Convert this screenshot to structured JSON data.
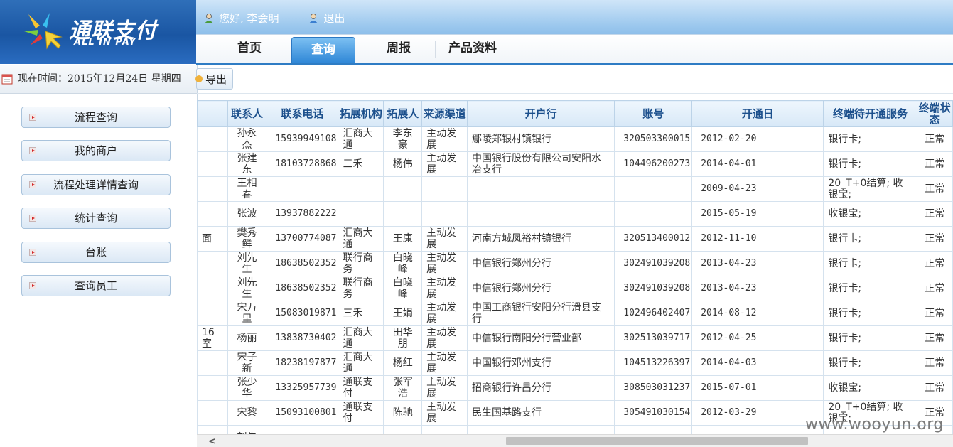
{
  "header": {
    "brand_cn": "通联支付",
    "brand_en": "ALL IN PAY",
    "greeting": "您好, 李会明",
    "logout": "退出",
    "nav": [
      "首页",
      "查询",
      "周报",
      "产品资料"
    ],
    "active_nav": "查询"
  },
  "sidebar": {
    "date_label": "现在时间：",
    "date_value": "2015年12月24日 星期四",
    "items": [
      "流程查询",
      "我的商户",
      "流程处理详情查询",
      "统计查询",
      "台账",
      "查询员工"
    ]
  },
  "toolbar": {
    "export_label": "导出"
  },
  "table": {
    "columns": [
      "联系人",
      "联系电话",
      "拓展机构",
      "拓展人",
      "来源渠道",
      "开户行",
      "账号",
      "开通日",
      "终端待开通服务",
      "终端状态"
    ],
    "rows": [
      {
        "prefix": "",
        "contact": "孙永杰",
        "phone": "15939949108",
        "org": "汇商大通",
        "agent": "李东豪",
        "channel": "主动发展",
        "bank": "鄢陵郑银村镇银行",
        "account": "320503300015",
        "date": "2012-02-20",
        "service": "银行卡;",
        "status": "正常"
      },
      {
        "prefix": "",
        "contact": "张建东",
        "phone": "18103728868",
        "org": "三禾",
        "agent": "杨伟",
        "channel": "主动发展",
        "bank": "中国银行股份有限公司安阳水冶支行",
        "account": "104496200273",
        "date": "2014-04-01",
        "service": "银行卡;",
        "status": "正常"
      },
      {
        "prefix": "",
        "contact": "王相春",
        "phone": "",
        "org": "",
        "agent": "",
        "channel": "",
        "bank": "",
        "account": "",
        "date": "2009-04-23",
        "service": "20_T+0结算; 收银宝;",
        "status": "正常"
      },
      {
        "prefix": "",
        "contact": "张波",
        "phone": "13937882222",
        "org": "",
        "agent": "",
        "channel": "",
        "bank": "",
        "account": "",
        "date": "2015-05-19",
        "service": "收银宝;",
        "status": "正常"
      },
      {
        "prefix": "面",
        "contact": "樊秀鲜",
        "phone": "13700774087",
        "org": "汇商大通",
        "agent": "王康",
        "channel": "主动发展",
        "bank": "河南方城凤裕村镇银行",
        "account": "320513400012",
        "date": "2012-11-10",
        "service": "银行卡;",
        "status": "正常"
      },
      {
        "prefix": "",
        "contact": "刘先生",
        "phone": "18638502352",
        "org": "联行商务",
        "agent": "白晓峰",
        "channel": "主动发展",
        "bank": "中信银行郑州分行",
        "account": "302491039208",
        "date": "2013-04-23",
        "service": "银行卡;",
        "status": "正常"
      },
      {
        "prefix": "",
        "contact": "刘先生",
        "phone": "18638502352",
        "org": "联行商务",
        "agent": "白晓峰",
        "channel": "主动发展",
        "bank": "中信银行郑州分行",
        "account": "302491039208",
        "date": "2013-04-23",
        "service": "银行卡;",
        "status": "正常"
      },
      {
        "prefix": "",
        "contact": "宋万里",
        "phone": "15083019871",
        "org": "三禾",
        "agent": "王娟",
        "channel": "主动发展",
        "bank": "中国工商银行安阳分行滑县支行",
        "account": "102496402407",
        "date": "2014-08-12",
        "service": "银行卡;",
        "status": "正常"
      },
      {
        "prefix": "16室",
        "contact": "杨丽",
        "phone": "13838730402",
        "org": "汇商大通",
        "agent": "田华朋",
        "channel": "主动发展",
        "bank": "中信银行南阳分行营业部",
        "account": "302513039717",
        "date": "2012-04-25",
        "service": "银行卡;",
        "status": "正常"
      },
      {
        "prefix": "",
        "contact": "宋子新",
        "phone": "18238197877",
        "org": "汇商大通",
        "agent": "杨红",
        "channel": "主动发展",
        "bank": "中国银行邓州支行",
        "account": "104513226397",
        "date": "2014-04-03",
        "service": "银行卡;",
        "status": "正常"
      },
      {
        "prefix": "",
        "contact": "张少华",
        "phone": "13325957739",
        "org": "通联支付",
        "agent": "张军浩",
        "channel": "主动发展",
        "bank": "招商银行许昌分行",
        "account": "308503031237",
        "date": "2015-07-01",
        "service": "收银宝;",
        "status": "正常"
      },
      {
        "prefix": "",
        "contact": "宋黎",
        "phone": "15093100801",
        "org": "通联支付",
        "agent": "陈驰",
        "channel": "主动发展",
        "bank": "民生国基路支行",
        "account": "305491030154",
        "date": "2012-03-29",
        "service": "20_T+0结算; 收银宝;",
        "status": "正常"
      },
      {
        "prefix": "",
        "contact": "刘先",
        "phone": "",
        "org": "",
        "agent": "",
        "channel": "",
        "bank": "",
        "account": "",
        "date": "",
        "service": "",
        "status": ""
      }
    ]
  },
  "watermark": "www.wooyun.org"
}
